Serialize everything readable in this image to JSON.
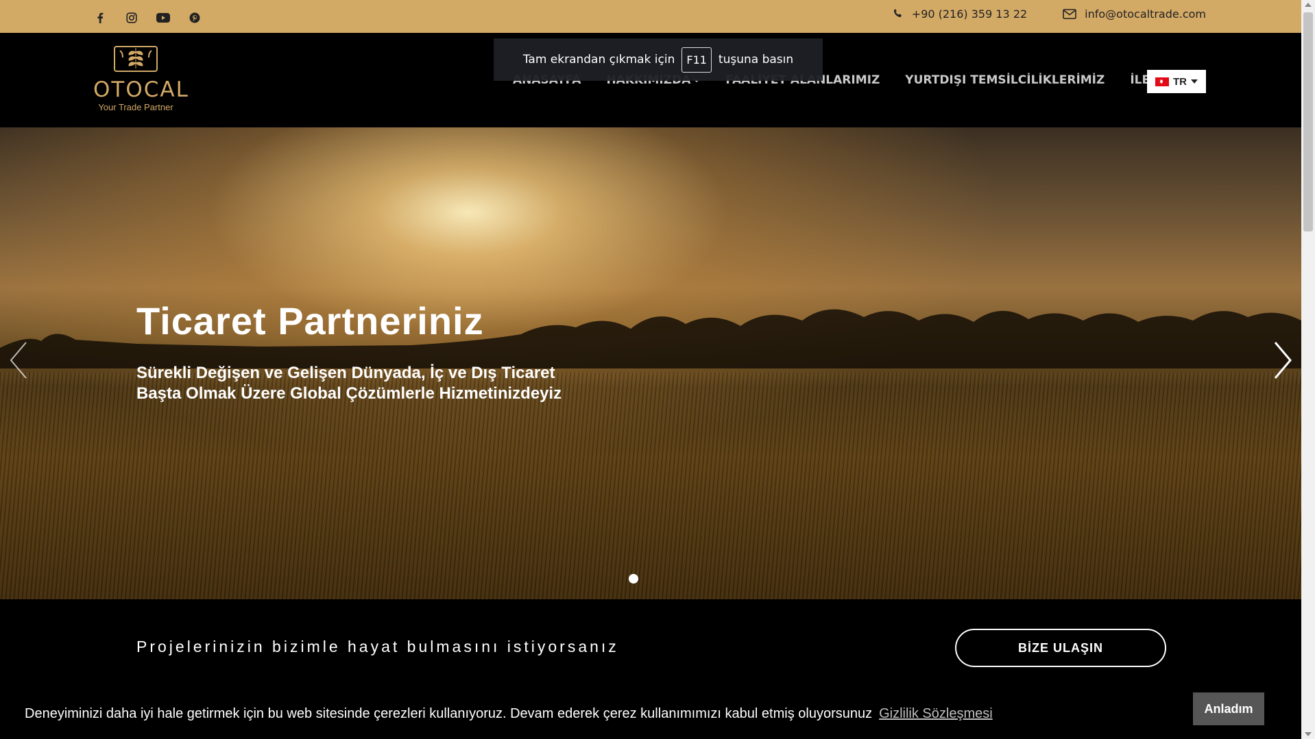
{
  "topbar": {
    "social": [
      "facebook-icon",
      "instagram-icon",
      "youtube-icon",
      "pinterest-icon"
    ],
    "phone": "+90 (216) 359 13 22",
    "email": "info@otocaltrade.com"
  },
  "header": {
    "logo_name": "OTOCAL",
    "logo_tagline": "Your Trade Partner",
    "nav": [
      {
        "label": "ANASAYFA"
      },
      {
        "label": "HAKKIMIZDA"
      },
      {
        "label": "FAALİYET ALANLARIMIZ"
      },
      {
        "label": "YURTDIŞI TEMSİLCİLİKLERİMİZ"
      },
      {
        "label": "İLETİŞİM"
      }
    ],
    "language": "TR"
  },
  "toast": {
    "before": "Tam ekrandan çıkmak için",
    "key": "F11",
    "after": "tuşuna basın"
  },
  "hero": {
    "title": "Ticaret Partneriniz",
    "subtitle_line1": "Sürekli Değişen ve Gelişen Dünyada, İç ve Dış Ticaret",
    "subtitle_line2": "Başta Olmak Üzere Global Çözümlerle Hizmetinizdeyiz"
  },
  "cta": {
    "text": "Projelerinizin bizimle hayat bulmasını istiyorsanız",
    "button": "BİZE ULAŞIN"
  },
  "cookie": {
    "text": "Deneyiminizi daha iyi hale getirmek için bu web sitesinde çerezleri kullanıyoruz. Devam ederek çerez kullanımımızı kabul etmiş oluyorsunuz",
    "link": "Gizlilik Sözleşmesi",
    "button": "Anladım"
  },
  "colors": {
    "topbar": "#d3a966",
    "gold": "#d3a966"
  }
}
